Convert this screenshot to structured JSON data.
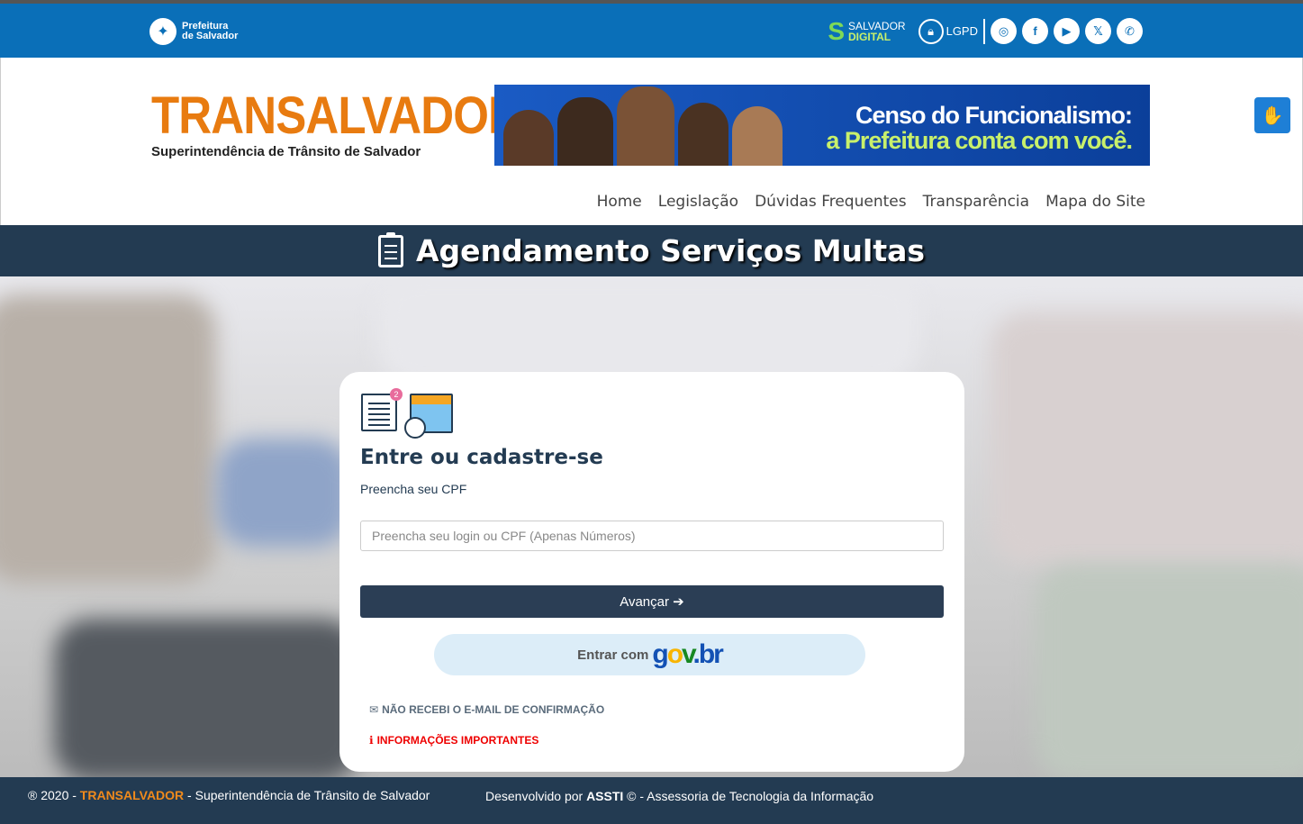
{
  "topbar": {
    "prefeitura_line1": "Prefeitura",
    "prefeitura_line2": "de Salvador",
    "salvador_digital_line1": "SALVADOR",
    "salvador_digital_line2": "DIGITAL",
    "lgpd_label": "LGPD",
    "social": [
      {
        "name": "instagram-icon",
        "glyph": "◎"
      },
      {
        "name": "facebook-icon",
        "glyph": "f"
      },
      {
        "name": "youtube-icon",
        "glyph": "▶"
      },
      {
        "name": "x-twitter-icon",
        "glyph": "𝕏"
      },
      {
        "name": "whatsapp-icon",
        "glyph": "✆"
      }
    ]
  },
  "header": {
    "brand_title": "TRANSALVADOR",
    "brand_subtitle": "Superintendência de Trânsito de Salvador",
    "banner_line1": "Censo do Funcionalismo:",
    "banner_line2": "a Prefeitura conta com você."
  },
  "nav": {
    "items": [
      "Home",
      "Legislação",
      "Dúvidas Frequentes",
      "Transparência",
      "Mapa do Site"
    ]
  },
  "page": {
    "title": "Agendamento Serviços Multas"
  },
  "login": {
    "badge_count": "2",
    "title": "Entre ou cadastre-se",
    "subtitle": "Preencha seu CPF",
    "cpf_placeholder": "Preencha seu login ou CPF (Apenas Números)",
    "cpf_value": "",
    "next_button": "Avançar",
    "gov_prefix": "Entrar com",
    "gov_logo": "gov.br",
    "link_email": "NÃO RECEBI O E-MAIL DE CONFIRMAÇÃO",
    "link_info": "INFORMAÇÕES IMPORTANTES"
  },
  "footer": {
    "left_prefix": "® 2020 - ",
    "left_brand": "TRANSALVADOR",
    "left_suffix": " - Superintendência de Trânsito de Salvador",
    "right_prefix": "Desenvolvido por ",
    "right_brand": "ASSTI",
    "right_suffix": " © - Assessoria de Tecnologia da Informação"
  },
  "colors": {
    "topbar": "#0a6fb8",
    "brand_orange": "#e87b10",
    "dark_navy": "#233b52",
    "link_red": "#ee0000"
  }
}
